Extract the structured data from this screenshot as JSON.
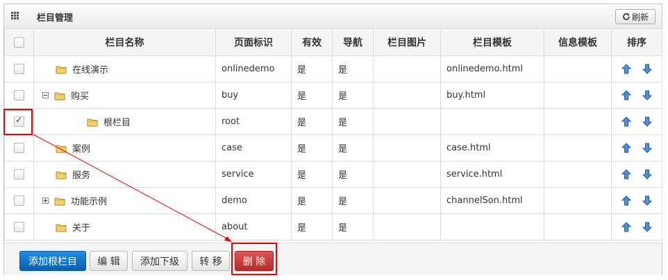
{
  "panel": {
    "title": "栏目管理",
    "refresh_label": "刷新"
  },
  "table": {
    "headers": [
      "栏目名称",
      "页面标识",
      "有效",
      "导航",
      "栏目图片",
      "栏目模板",
      "信息模板",
      "排序"
    ],
    "rows": [
      {
        "name": "在线演示",
        "page_id": "onlinedemo",
        "valid": "是",
        "nav": "是",
        "image": "",
        "template": "onlinedemo.html",
        "info_template": "",
        "checked": false,
        "expander": "",
        "indent": 1
      },
      {
        "name": "购买",
        "page_id": "buy",
        "valid": "是",
        "nav": "是",
        "image": "",
        "template": "buy.html",
        "info_template": "",
        "checked": false,
        "expander": "minus",
        "indent": 0
      },
      {
        "name": "根栏目",
        "page_id": "root",
        "valid": "是",
        "nav": "是",
        "image": "",
        "template": "",
        "info_template": "",
        "checked": true,
        "expander": "",
        "indent": 2
      },
      {
        "name": "案例",
        "page_id": "case",
        "valid": "是",
        "nav": "是",
        "image": "",
        "template": "case.html",
        "info_template": "",
        "checked": false,
        "expander": "",
        "indent": 1
      },
      {
        "name": "服务",
        "page_id": "service",
        "valid": "是",
        "nav": "是",
        "image": "",
        "template": "service.html",
        "info_template": "",
        "checked": false,
        "expander": "",
        "indent": 1
      },
      {
        "name": "功能示例",
        "page_id": "demo",
        "valid": "是",
        "nav": "是",
        "image": "",
        "template": "channelSon.html",
        "info_template": "",
        "checked": false,
        "expander": "plus",
        "indent": 0
      },
      {
        "name": "关于",
        "page_id": "about",
        "valid": "是",
        "nav": "是",
        "image": "",
        "template": "",
        "info_template": "",
        "checked": false,
        "expander": "",
        "indent": 1
      }
    ]
  },
  "toolbar": {
    "add_root_label": "添加根栏目",
    "edit_label": "编 辑",
    "add_child_label": "添加下级",
    "move_label": "转 移",
    "delete_label": "删 除"
  },
  "colors": {
    "primary": "#0a5fb2",
    "danger": "#b72a2a",
    "highlight": "#e00000",
    "sort_arrow": "#2a6fc9"
  },
  "icons": {
    "grid": "grid-icon",
    "refresh": "refresh-icon",
    "folder": "folder-icon",
    "up": "arrow-up-icon",
    "down": "arrow-down-icon"
  }
}
